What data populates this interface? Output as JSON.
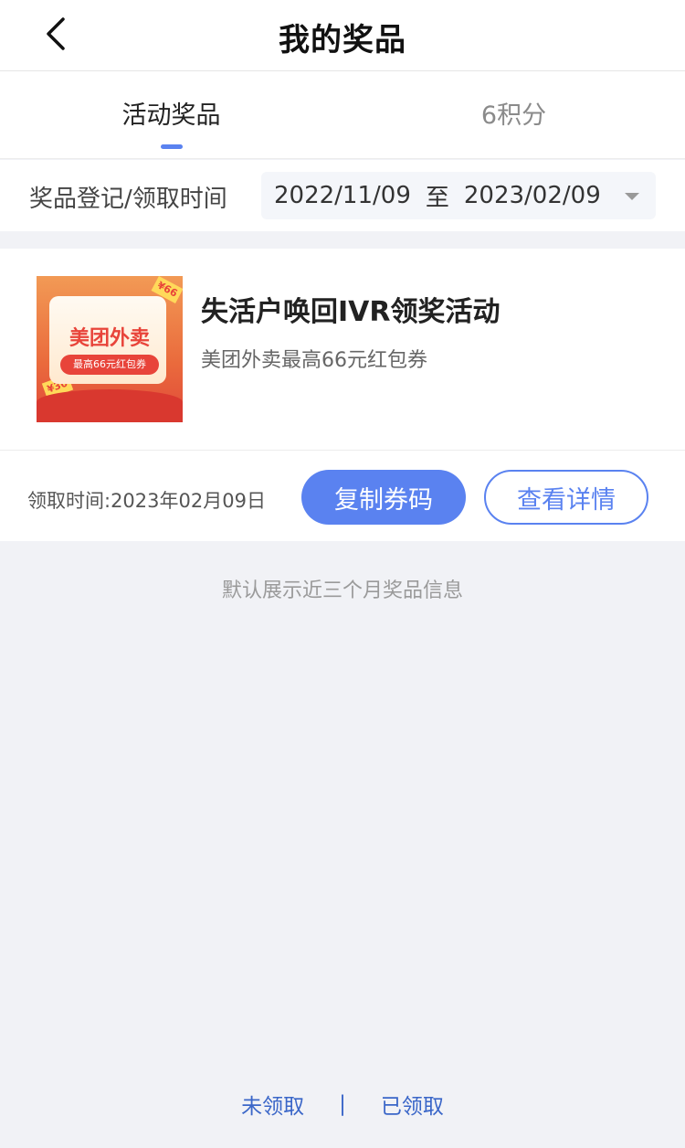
{
  "header": {
    "title": "我的奖品",
    "back_icon": "chevron-left-icon"
  },
  "tabs": [
    {
      "label": "活动奖品",
      "active": true
    },
    {
      "label": "6积分",
      "active": false
    }
  ],
  "filter": {
    "label": "奖品登记/领取时间",
    "start_date": "2022/11/09",
    "separator": "至",
    "end_date": "2023/02/09",
    "dropdown_icon": "caret-down-icon"
  },
  "prize": {
    "image_brand": "美团外卖",
    "image_badge": "最高66元红包券",
    "image_ticket_a": "¥66",
    "image_ticket_b": "¥30",
    "title": "失活户唤回IVR领奖活动",
    "description": "美团外卖最高66元红包券",
    "receive_time": "领取时间:2023年02月09日",
    "copy_button": "复制券码",
    "detail_button": "查看详情"
  },
  "notice": "默认展示近三个月奖品信息",
  "footer": {
    "unclaimed": "未领取",
    "divider": "|",
    "claimed": "已领取"
  },
  "colors": {
    "accent": "#5a82f0",
    "link": "#3a66c8",
    "background": "#f1f2f6"
  }
}
